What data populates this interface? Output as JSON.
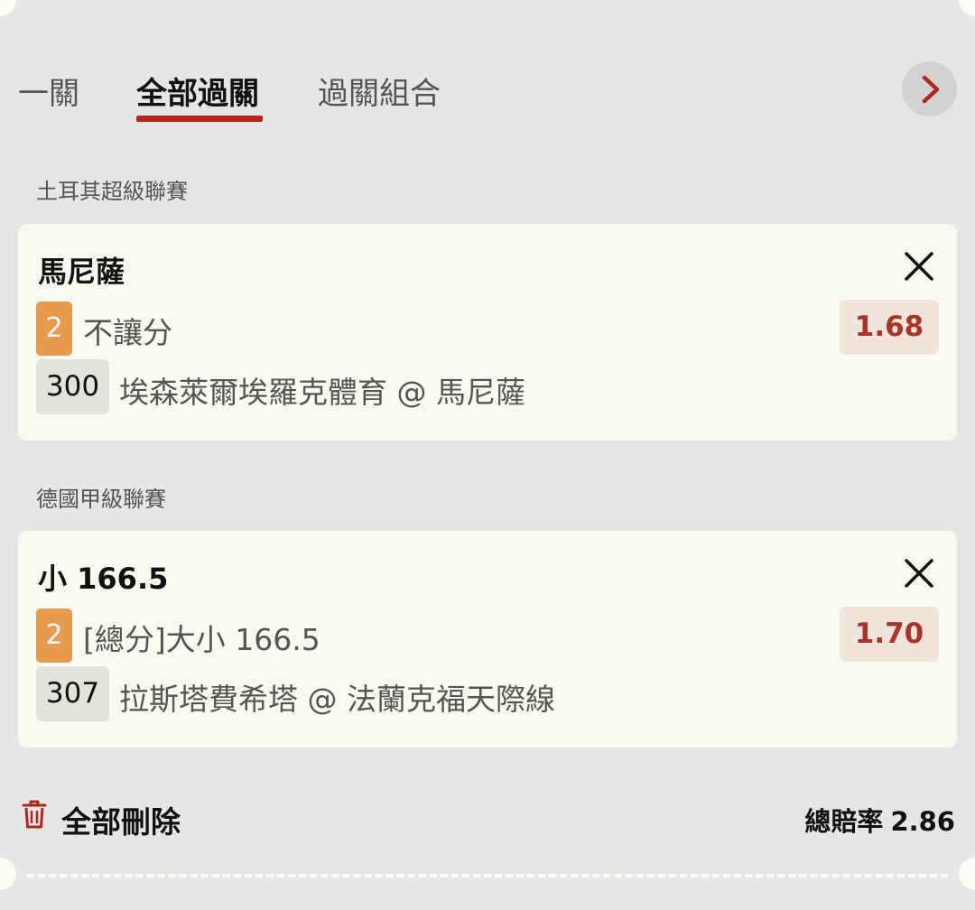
{
  "tabs": [
    {
      "label": "一關",
      "active": false
    },
    {
      "label": "全部過關",
      "active": true
    },
    {
      "label": "過關組合",
      "active": false
    }
  ],
  "next_icon": "chevron-right-icon",
  "colors": {
    "accent": "#b3261e",
    "odds_text": "#a8352a",
    "odds_bg": "#f0e4dd",
    "badge": "#ea9a4f",
    "card_bg": "#fbfaf1",
    "page_bg": "#e6e6e6"
  },
  "bets": [
    {
      "league": "土耳其超級聯賽",
      "selection": "馬尼薩",
      "badge": "2",
      "market": "不讓分",
      "odds": "1.68",
      "match_no": "300",
      "match": "埃森萊爾埃羅克體育 @ 馬尼薩"
    },
    {
      "league": "德國甲級聯賽",
      "selection": "小 166.5",
      "badge": "2",
      "market": "[總分]大小 166.5",
      "odds": "1.70",
      "match_no": "307",
      "match": "拉斯塔費希塔 @ 法蘭克福天際線"
    }
  ],
  "footer": {
    "delete_all": "全部刪除",
    "total_odds_label": "總賠率",
    "total_odds_value": "2.86"
  }
}
